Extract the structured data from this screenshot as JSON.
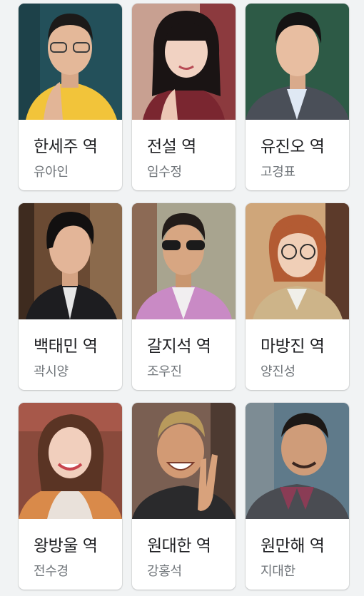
{
  "cast": [
    {
      "role": "한세주 역",
      "actor": "유아인"
    },
    {
      "role": "전설 역",
      "actor": "임수정"
    },
    {
      "role": "유진오 역",
      "actor": "고경표"
    },
    {
      "role": "백태민 역",
      "actor": "곽시양"
    },
    {
      "role": "갈지석 역",
      "actor": "조우진"
    },
    {
      "role": "마방진 역",
      "actor": "양진성"
    },
    {
      "role": "왕방울 역",
      "actor": "전수경"
    },
    {
      "role": "원대한 역",
      "actor": "강홍석"
    },
    {
      "role": "원만해 역",
      "actor": "지대한"
    }
  ],
  "colors": {
    "page_background": "#f1f3f4",
    "card_background": "#ffffff",
    "role_text": "#202124",
    "actor_text": "#70757a"
  }
}
